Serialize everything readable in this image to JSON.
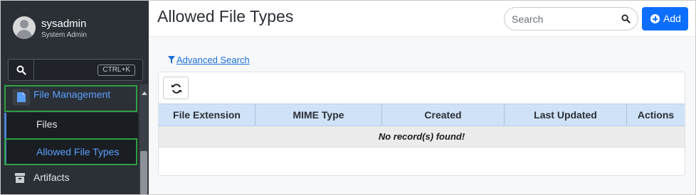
{
  "user": {
    "name": "sysadmin",
    "role": "System Admin"
  },
  "sidebar": {
    "search_shortcut": "CTRL+K",
    "items": [
      {
        "label": "File Management",
        "children": [
          {
            "label": "Files"
          },
          {
            "label": "Allowed File Types"
          }
        ]
      },
      {
        "label": "Artifacts"
      }
    ]
  },
  "header": {
    "title": "Allowed File Types",
    "search_placeholder": "Search",
    "add_label": "Add"
  },
  "advanced_search": {
    "label": " Advanced Search"
  },
  "table": {
    "columns": [
      "File Extension",
      "MIME Type",
      "Created",
      "Last Updated",
      "Actions"
    ],
    "empty_message": "No record(s) found!"
  },
  "colors": {
    "accent": "#0d6efd",
    "sidebar_bg": "#2b2f36",
    "highlight_box": "#2ea043",
    "header_row": "#cfe2f7"
  },
  "icons": [
    "avatar-icon",
    "search-icon",
    "file-icon",
    "archive-icon",
    "plus-circle-icon",
    "filter-icon",
    "refresh-icon"
  ]
}
